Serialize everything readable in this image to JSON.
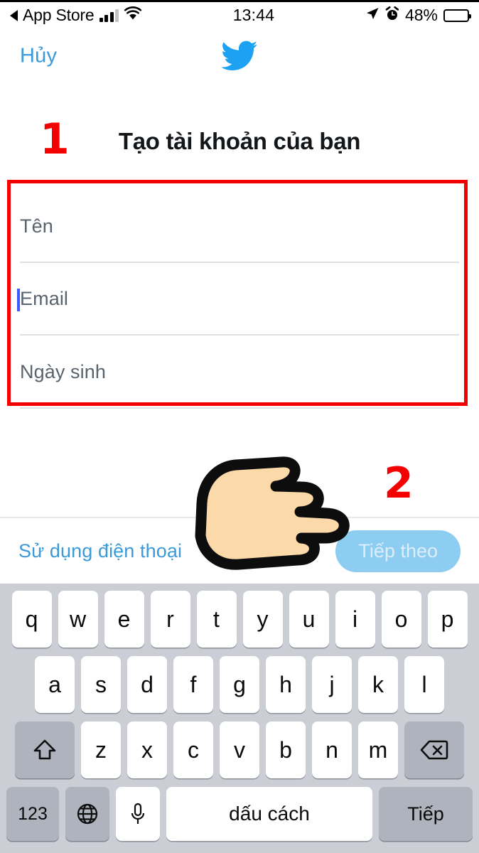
{
  "status_bar": {
    "back_app": "App Store",
    "back_icon": "back-triangle-icon",
    "signal_icon": "cellular-signal-icon",
    "wifi_icon": "wifi-icon",
    "time": "13:44",
    "location_icon": "location-arrow-icon",
    "alarm_icon": "alarm-clock-icon",
    "battery_percent": "48%",
    "battery_level": 48
  },
  "nav": {
    "cancel_label": "Hủy",
    "logo_icon": "twitter-bird-icon",
    "logo_color": "#1da1f2"
  },
  "header": {
    "title": "Tạo tài khoản của bạn"
  },
  "annotations": {
    "step_one": "1",
    "step_two": "2",
    "highlight_color": "#f40000",
    "hand_icon": "pointing-hand-right-icon"
  },
  "form": {
    "fields": [
      {
        "name": "name",
        "placeholder": "Tên",
        "value": ""
      },
      {
        "name": "email",
        "placeholder": "Email",
        "value": "",
        "focused": true
      },
      {
        "name": "birthdate",
        "placeholder": "Ngày sinh",
        "value": ""
      }
    ]
  },
  "bottom_bar": {
    "phone_link": "Sử dụng điện thoại",
    "next_button": "Tiếp theo",
    "next_button_color": "#8ecdf2"
  },
  "keyboard": {
    "row1": [
      "q",
      "w",
      "e",
      "r",
      "t",
      "y",
      "u",
      "i",
      "o",
      "p"
    ],
    "row2": [
      "a",
      "s",
      "d",
      "f",
      "g",
      "h",
      "j",
      "k",
      "l"
    ],
    "row3": [
      "z",
      "x",
      "c",
      "v",
      "b",
      "n",
      "m"
    ],
    "shift_icon": "shift-up-arrow-icon",
    "backspace_icon": "backspace-delete-icon",
    "numbers_key": "123",
    "globe_icon": "globe-language-icon",
    "mic_icon": "microphone-icon",
    "space_key": "dấu cách",
    "return_key": "Tiếp"
  }
}
